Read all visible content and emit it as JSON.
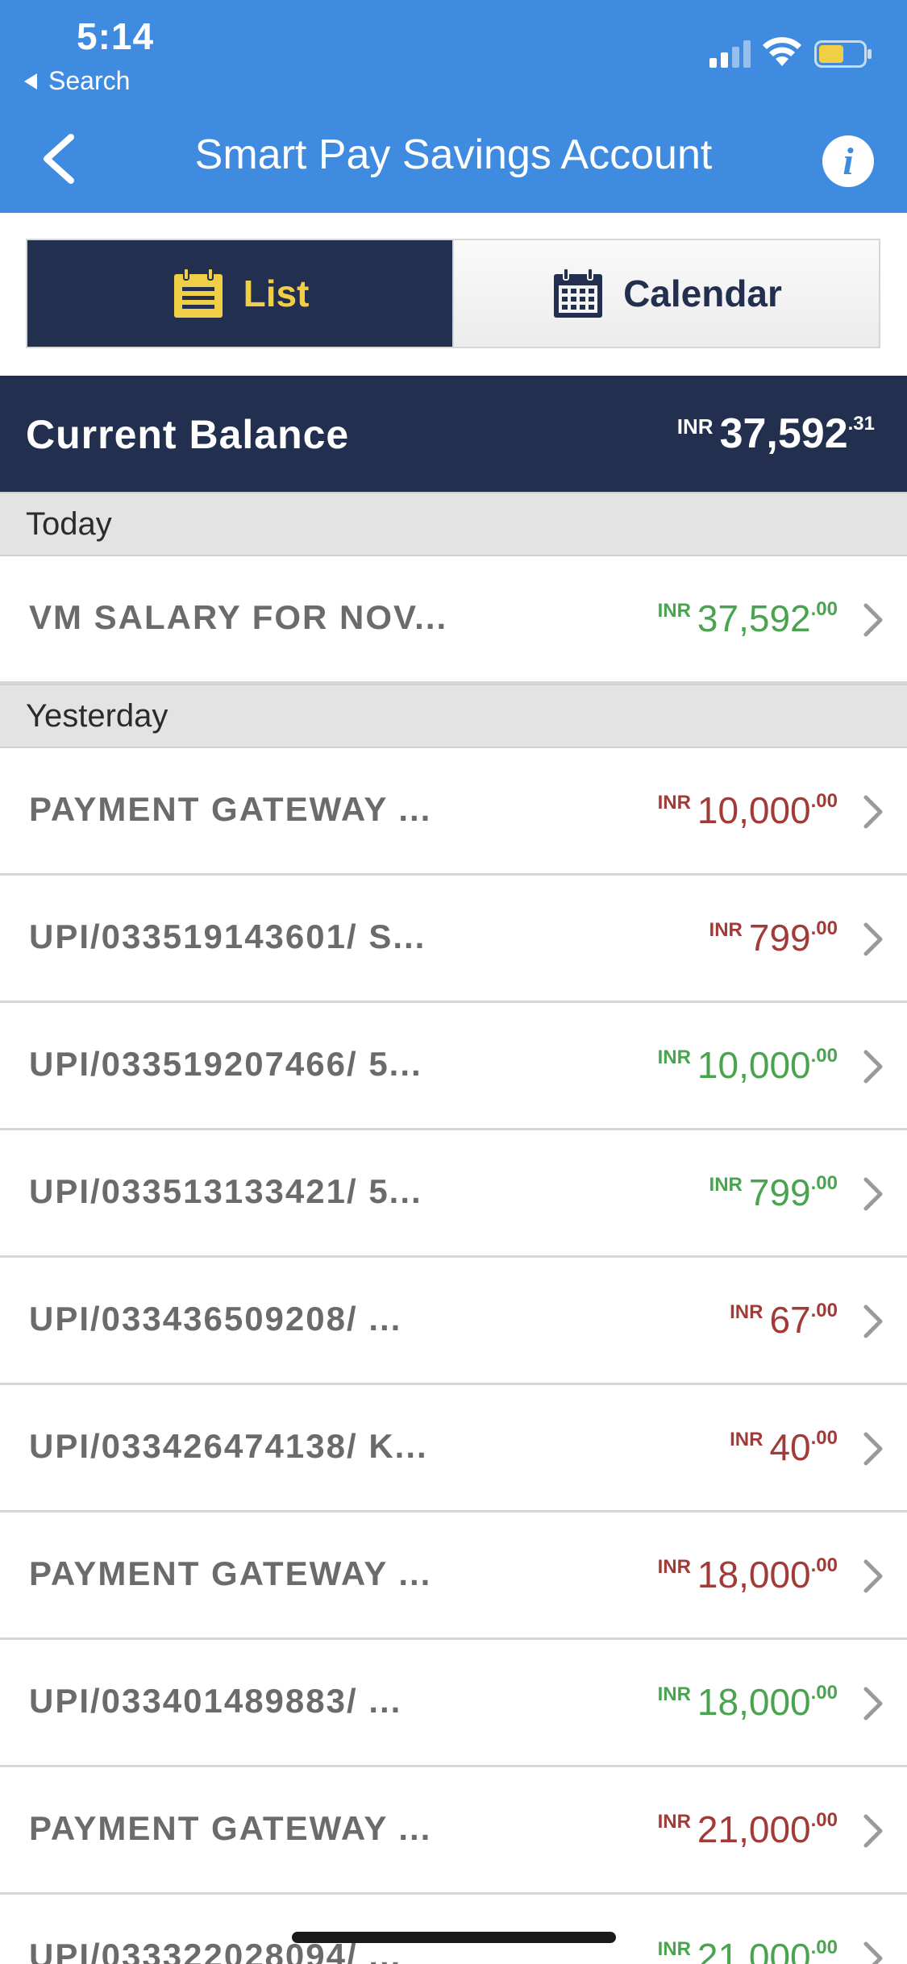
{
  "status_bar": {
    "time": "5:14",
    "back_app_label": "Search"
  },
  "nav": {
    "title": "Smart Pay Savings Account",
    "info_label": "i"
  },
  "view_toggle": {
    "list_label": "List",
    "calendar_label": "Calendar",
    "selected": "List"
  },
  "balance": {
    "label": "Current Balance",
    "currency": "INR",
    "whole": "37,592",
    "decimal": ".31"
  },
  "sections": [
    {
      "title": "Today",
      "transactions": [
        {
          "description": "VM SALARY FOR NOV...",
          "currency": "INR",
          "whole": "37,592",
          "decimal": ".00",
          "type": "credit"
        }
      ]
    },
    {
      "title": "Yesterday",
      "transactions": [
        {
          "description": "PAYMENT GATEWAY ...",
          "currency": "INR",
          "whole": "10,000",
          "decimal": ".00",
          "type": "debit"
        },
        {
          "description": "UPI/033519143601/ S...",
          "currency": "INR",
          "whole": "799",
          "decimal": ".00",
          "type": "debit"
        },
        {
          "description": "UPI/033519207466/ 5...",
          "currency": "INR",
          "whole": "10,000",
          "decimal": ".00",
          "type": "credit"
        },
        {
          "description": "UPI/033513133421/ 5...",
          "currency": "INR",
          "whole": "799",
          "decimal": ".00",
          "type": "credit"
        },
        {
          "description": "UPI/033436509208/ ...",
          "currency": "INR",
          "whole": "67",
          "decimal": ".00",
          "type": "debit"
        },
        {
          "description": "UPI/033426474138/ K...",
          "currency": "INR",
          "whole": "40",
          "decimal": ".00",
          "type": "debit"
        },
        {
          "description": "PAYMENT GATEWAY ...",
          "currency": "INR",
          "whole": "18,000",
          "decimal": ".00",
          "type": "debit"
        },
        {
          "description": "UPI/033401489883/ ...",
          "currency": "INR",
          "whole": "18,000",
          "decimal": ".00",
          "type": "credit"
        },
        {
          "description": "PAYMENT GATEWAY ...",
          "currency": "INR",
          "whole": "21,000",
          "decimal": ".00",
          "type": "debit"
        },
        {
          "description": "UPI/033322028094/ ...",
          "currency": "INR",
          "whole": "21,000",
          "decimal": ".00",
          "type": "credit"
        }
      ]
    }
  ],
  "colors": {
    "header_blue": "#3f8be0",
    "navy": "#222f4f",
    "accent_yellow": "#f0ce46",
    "credit_green": "#4aa44f",
    "debit_red": "#a23a37"
  },
  "icons": {
    "back": "chevron-left-icon",
    "info": "info-icon",
    "list": "list-icon",
    "calendar": "calendar-icon",
    "row_disclosure": "chevron-right-icon"
  }
}
